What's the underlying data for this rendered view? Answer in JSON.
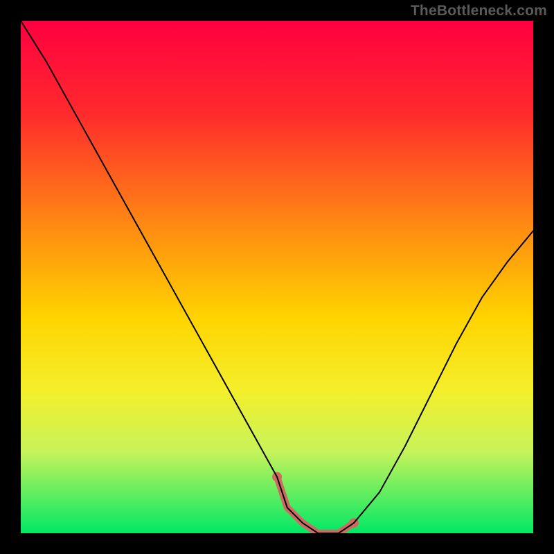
{
  "watermark": "TheBottleneck.com",
  "chart_data": {
    "type": "line",
    "title": "",
    "xlabel": "",
    "ylabel": "",
    "xlim": [
      0,
      100
    ],
    "ylim": [
      0,
      100
    ],
    "gradient_stops": [
      {
        "offset": 0,
        "color": "#ff0040"
      },
      {
        "offset": 18,
        "color": "#ff2a2d"
      },
      {
        "offset": 40,
        "color": "#ff8a12"
      },
      {
        "offset": 58,
        "color": "#ffd400"
      },
      {
        "offset": 72,
        "color": "#f4ef2a"
      },
      {
        "offset": 84,
        "color": "#c8f35a"
      },
      {
        "offset": 100,
        "color": "#00e865"
      }
    ],
    "series": [
      {
        "name": "curve",
        "color": "#000000",
        "width": 2,
        "x": [
          0,
          5,
          10,
          15,
          20,
          25,
          30,
          35,
          40,
          45,
          50,
          52,
          55,
          58,
          62,
          65,
          70,
          75,
          80,
          85,
          90,
          95,
          100
        ],
        "y": [
          100,
          92,
          83,
          74,
          65,
          56,
          47,
          38,
          29,
          20,
          11,
          5,
          2,
          0,
          0,
          2,
          8,
          17,
          27,
          37,
          46,
          53,
          59
        ]
      }
    ],
    "highlight": {
      "name": "bottom-band",
      "color": "#cf6a63",
      "width": 10,
      "x": [
        50,
        52,
        55,
        58,
        62,
        65
      ],
      "y": [
        11,
        5,
        2,
        0,
        0,
        2
      ]
    }
  }
}
